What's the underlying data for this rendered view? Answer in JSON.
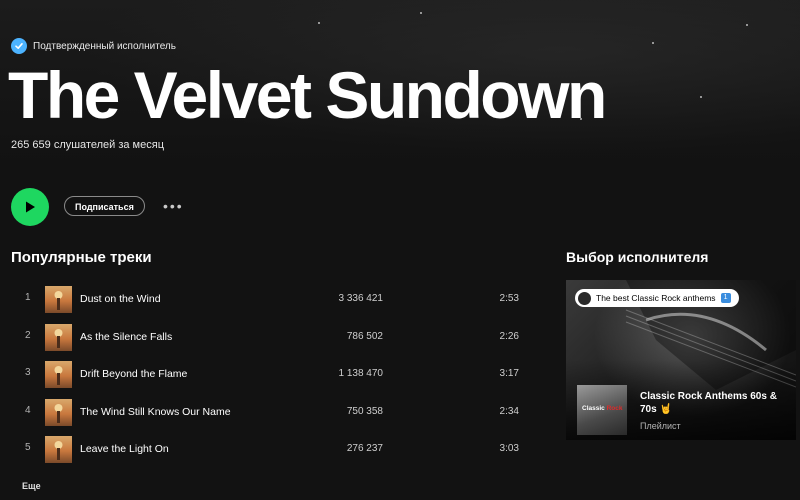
{
  "artist": {
    "verified_label": "Подтвержденный исполнитель",
    "name": "The Velvet Sundown",
    "monthly_listeners": "265 659 слушателей за месяц"
  },
  "controls": {
    "follow_label": "Подписаться",
    "more_icon": "ellipsis-icon",
    "play_icon": "play-icon"
  },
  "popular": {
    "heading": "Популярные треки",
    "tracks": [
      {
        "num": "1",
        "title": "Dust on the Wind",
        "plays": "3 336 421",
        "duration": "2:53"
      },
      {
        "num": "2",
        "title": "As the Silence Falls",
        "plays": "786 502",
        "duration": "2:26"
      },
      {
        "num": "3",
        "title": "Drift Beyond the Flame",
        "plays": "1 138 470",
        "duration": "3:17"
      },
      {
        "num": "4",
        "title": "The Wind Still Knows Our Name",
        "plays": "750 358",
        "duration": "2:34"
      },
      {
        "num": "5",
        "title": "Leave the Light On",
        "plays": "276 237",
        "duration": "3:03"
      }
    ],
    "more_label": "Еще"
  },
  "artist_pick": {
    "heading": "Выбор исполнителя",
    "badge_text": "The best Classic Rock anthems",
    "badge_number": "1",
    "cover_text_prefix": "Classic",
    "cover_text_highlight": "Rock",
    "playlist_title": "Classic Rock Anthems 60s & 70s 🤘",
    "playlist_type": "Плейлист"
  },
  "colors": {
    "accent": "#1ed760",
    "verified": "#4cb3ff",
    "background": "#121212"
  }
}
